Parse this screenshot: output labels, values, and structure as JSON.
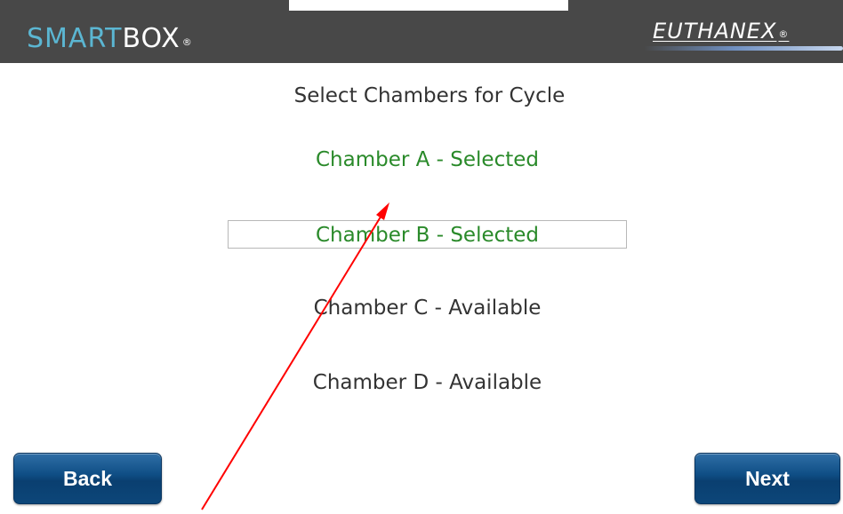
{
  "header": {
    "logo_left_smart": "SMART",
    "logo_left_box": "BOX",
    "logo_left_mark": "®",
    "logo_right": "EUTHANEX",
    "logo_right_mark": "®",
    "background_color": "#484848"
  },
  "main": {
    "title": "Select Chambers for Cycle",
    "chambers": [
      {
        "label": "Chamber A - Selected",
        "status": "selected",
        "focused": false
      },
      {
        "label": "Chamber B - Selected",
        "status": "selected",
        "focused": true
      },
      {
        "label": "Chamber C - Available",
        "status": "available",
        "focused": false
      },
      {
        "label": "Chamber D - Available",
        "status": "available",
        "focused": false
      }
    ],
    "selected_color": "#2a8a2a",
    "available_color": "#333333"
  },
  "footer": {
    "back_label": "Back",
    "next_label": "Next",
    "button_color": "#0f4e85"
  },
  "annotation": {
    "icon": "red-arrow-icon",
    "color": "#ff0000"
  }
}
